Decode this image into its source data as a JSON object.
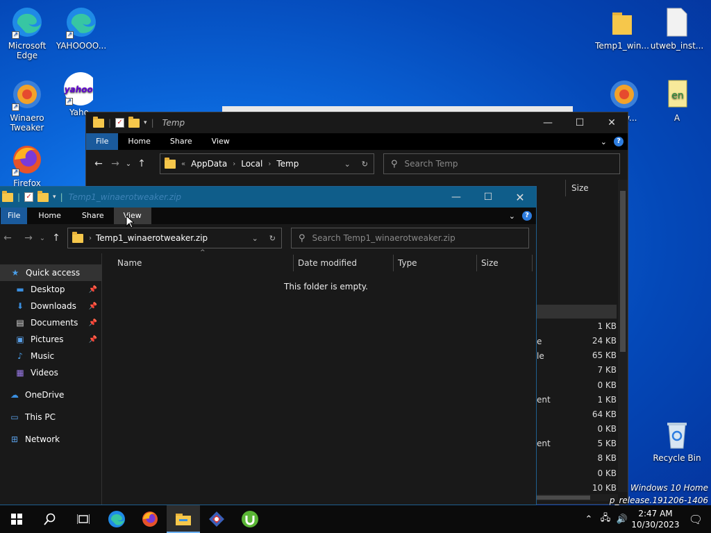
{
  "desktop_icons": [
    {
      "label": "Microsoft Edge",
      "icon": "edge-icon"
    },
    {
      "label": "YAHOOOO...",
      "icon": "edge-icon"
    },
    {
      "label": "Winaero Tweaker",
      "icon": "winaero-icon"
    },
    {
      "label": "Yaho",
      "icon": "yahoo-icon"
    },
    {
      "label": "Firefox",
      "icon": "firefox-icon"
    },
    {
      "label": "Temp1_win...",
      "icon": "folder-icon"
    },
    {
      "label": "utweb_inst...",
      "icon": "file-icon"
    },
    {
      "label": "...Tw...",
      "icon": "winaero-icon"
    },
    {
      "label": "A",
      "icon": "text-file-icon"
    },
    {
      "label": "Recycle Bin",
      "icon": "recycle-bin-icon"
    }
  ],
  "yahoo_logo_text": "yahoo!",
  "back_window": {
    "title": "Temp",
    "ribbon": [
      "File",
      "Home",
      "Share",
      "View"
    ],
    "path": [
      "AppData",
      "Local",
      "Temp"
    ],
    "search_placeholder": "Search Temp",
    "col_size": "Size",
    "type_fragments": [
      "e",
      "le",
      "ent",
      "ent"
    ],
    "sizes": [
      "1 KB",
      "24 KB",
      "65 KB",
      "7 KB",
      "0 KB",
      "1 KB",
      "64 KB",
      "0 KB",
      "5 KB",
      "8 KB",
      "0 KB",
      "10 KB"
    ]
  },
  "front_window": {
    "title": "Temp1_winaerotweaker.zip",
    "ribbon": [
      "File",
      "Home",
      "Share",
      "View"
    ],
    "path": "Temp1_winaerotweaker.zip",
    "search_placeholder": "Search Temp1_winaerotweaker.zip",
    "columns": [
      "Name",
      "Date modified",
      "Type",
      "Size"
    ],
    "empty_message": "This folder is empty.",
    "nav": [
      {
        "label": "Quick access",
        "icon": "star-icon",
        "color": "#4a9ee8"
      },
      {
        "label": "Desktop",
        "icon": "desktop-icon",
        "color": "#3a8fe0",
        "pinned": true
      },
      {
        "label": "Downloads",
        "icon": "download-icon",
        "color": "#3a8fe0",
        "pinned": true
      },
      {
        "label": "Documents",
        "icon": "document-icon",
        "color": "#dddddd",
        "pinned": true
      },
      {
        "label": "Pictures",
        "icon": "pictures-icon",
        "color": "#5aa0e8",
        "pinned": true
      },
      {
        "label": "Music",
        "icon": "music-icon",
        "color": "#4a9ee8"
      },
      {
        "label": "Videos",
        "icon": "video-icon",
        "color": "#9a7ae8"
      },
      {
        "label": "OneDrive",
        "icon": "onedrive-icon",
        "color": "#3a8fe0"
      },
      {
        "label": "This PC",
        "icon": "computer-icon",
        "color": "#5aa0e8"
      },
      {
        "label": "Network",
        "icon": "network-icon",
        "color": "#5aa0e8"
      }
    ]
  },
  "watermark": {
    "line1": "Windows 10 Home",
    "line2": "p_release.191206-1406"
  },
  "taskbar": {
    "apps": [
      "start-icon",
      "search-icon",
      "task-view-icon",
      "edge-icon",
      "firefox-icon",
      "file-explorer-icon",
      "winaero-icon",
      "utorrent-icon"
    ],
    "time": "2:47 AM",
    "date": "10/30/2023"
  }
}
